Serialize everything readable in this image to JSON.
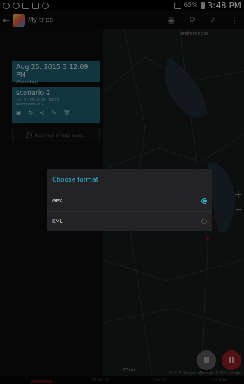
{
  "status_bar": {
    "battery": "65%",
    "time": "3:48 PM"
  },
  "action_bar": {
    "back_glyph": "←",
    "title": "My trips",
    "actions": [
      {
        "icon": "eye-icon",
        "glyph": "◉"
      },
      {
        "icon": "navigation-icon",
        "glyph": "⚲"
      },
      {
        "icon": "checkmark-icon",
        "glyph": "✓"
      },
      {
        "icon": "more-icon",
        "glyph": "⋮"
      }
    ]
  },
  "map": {
    "overlay_label": "preferences",
    "zoom_in_glyph": "+",
    "zoom_out_glyph": "−",
    "scale": "25mi",
    "copyright": "©2015 Google · Map data ©2015 Google"
  },
  "recording_card": {
    "title": "Aug 25, 2015 3:12:09 PM",
    "status": "(Recording)"
  },
  "scenario_card": {
    "title": "scenario 2",
    "details": "197 ft · 00:01:34 · Today",
    "description": "description of 2",
    "actions": [
      {
        "icon": "map-icon",
        "glyph": "▣"
      },
      {
        "icon": "refresh-icon",
        "glyph": "↻"
      },
      {
        "icon": "share-icon",
        "glyph": "<"
      },
      {
        "icon": "edit-icon",
        "glyph": "✎"
      },
      {
        "icon": "delete-icon",
        "glyph": "🗑"
      }
    ]
  },
  "add_map": {
    "plus_glyph": "+",
    "label": "Add new empty map..."
  },
  "bottom_bar": {
    "time": "00:34:31",
    "distance": "105 mi",
    "speed": "332 mph"
  },
  "dialog": {
    "title": "Choose format",
    "options": [
      {
        "label": "GPX",
        "selected": true
      },
      {
        "label": "KML",
        "selected": false
      }
    ]
  },
  "colors": {
    "accent": "#35b2d8",
    "card": "#1f5b6c",
    "record": "#8a1e24"
  }
}
